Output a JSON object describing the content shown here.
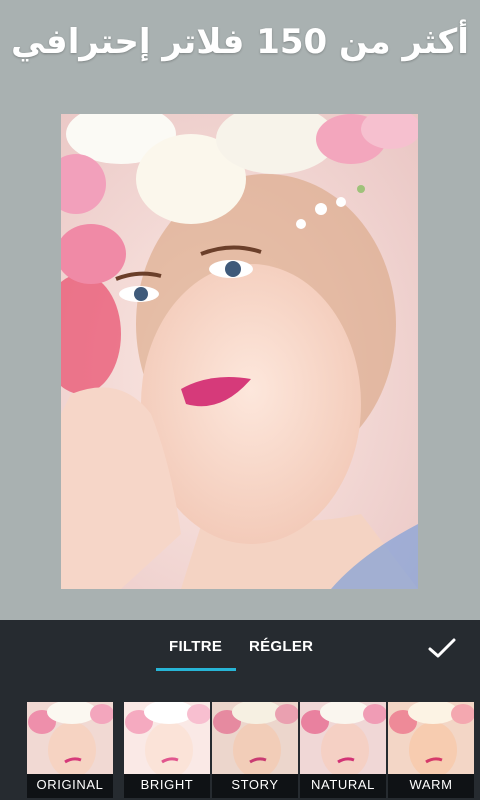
{
  "promo": {
    "headline": "أكثر من 150 فلاتر إحترافي"
  },
  "photo": {
    "alt": "portrait-with-flower-crown"
  },
  "tabs": [
    {
      "label": "FILTRE",
      "active": true
    },
    {
      "label": "RÉGLER",
      "active": false
    }
  ],
  "filters": [
    {
      "label": "ORIGINAL"
    },
    {
      "label": "BRIGHT"
    },
    {
      "label": "STORY"
    },
    {
      "label": "NATURAL"
    },
    {
      "label": "WARM"
    }
  ],
  "colors": {
    "background": "#a9b1b1",
    "panel": "#262b30",
    "accent": "#27b5d6"
  },
  "icons": {
    "compare": "compare-icon",
    "apply": "checkmark-icon"
  }
}
